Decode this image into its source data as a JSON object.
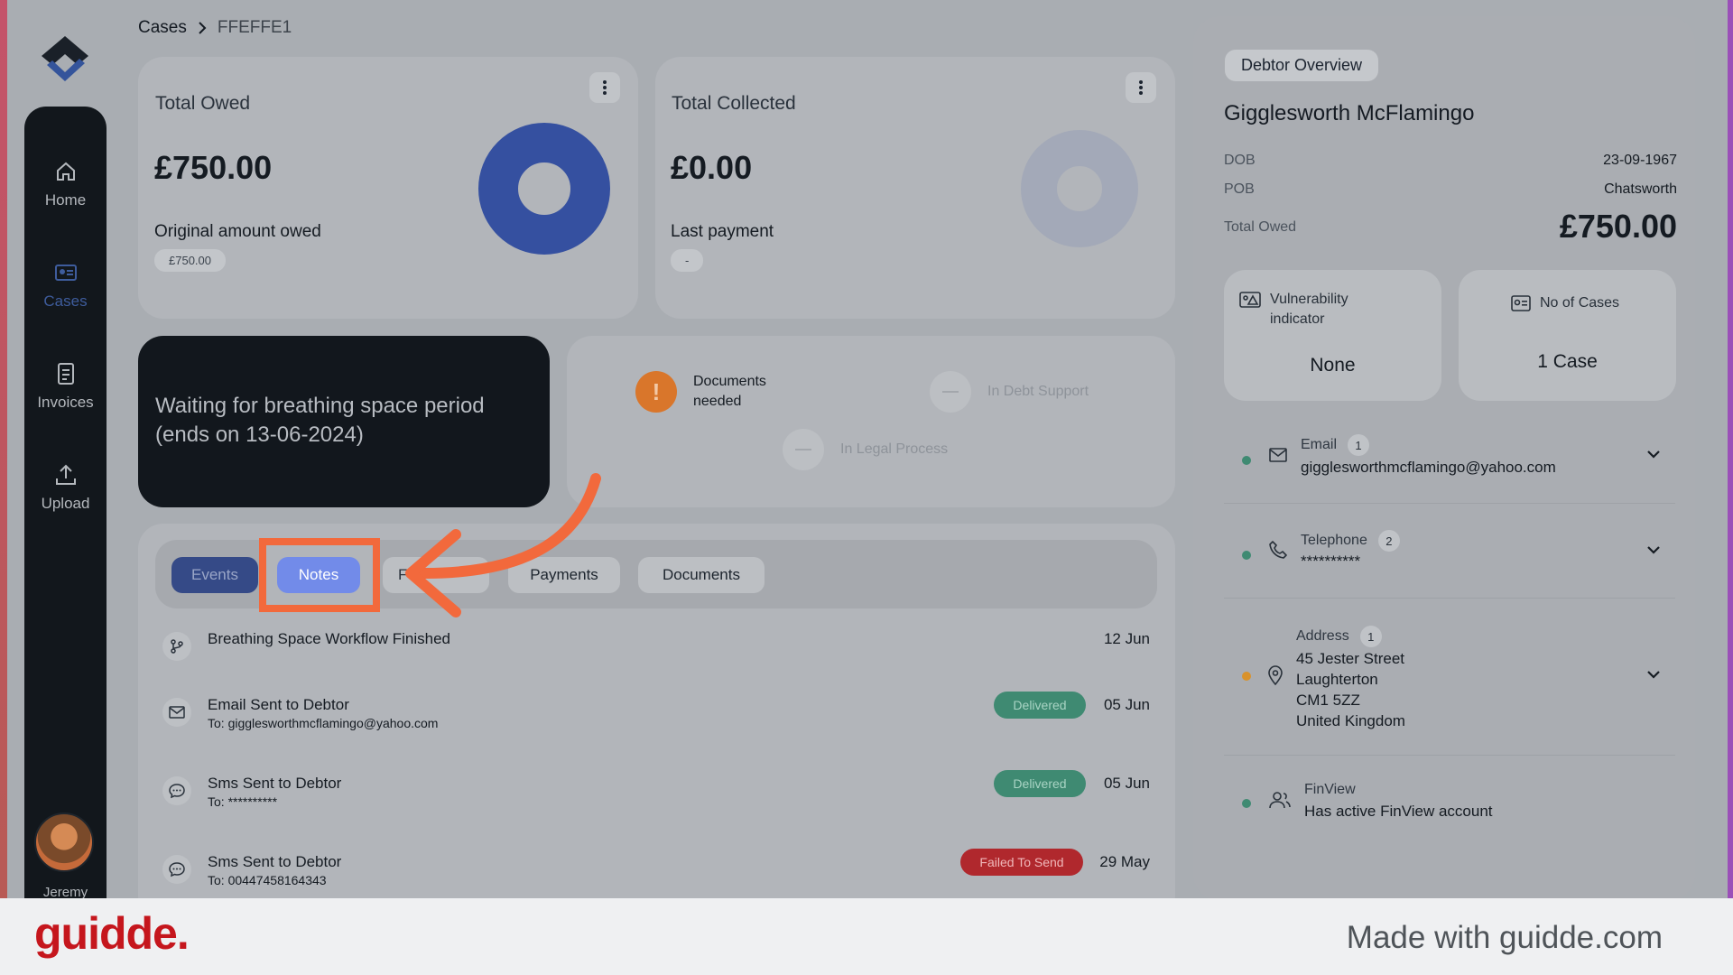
{
  "colors": {
    "accent": "#5b78e6",
    "brand_red": "#c5161d",
    "annotation": "#f2693c",
    "delivered": "#3f8a72",
    "failed": "#b0282d",
    "warning": "#d9762b"
  },
  "sidebar": {
    "items": [
      {
        "label": "Home",
        "icon": "home-icon",
        "active": false
      },
      {
        "label": "Cases",
        "icon": "cases-icon",
        "active": true
      },
      {
        "label": "Invoices",
        "icon": "invoice-icon",
        "active": false
      },
      {
        "label": "Upload",
        "icon": "upload-icon",
        "active": false
      }
    ],
    "user_name": "Jeremy"
  },
  "breadcrumb": {
    "root": "Cases",
    "current": "FFEFFE1"
  },
  "total_owed": {
    "title": "Total Owed",
    "amount": "£750.00",
    "sub_label": "Original amount owed",
    "sub_value": "£750.00"
  },
  "total_collected": {
    "title": "Total Collected",
    "amount": "£0.00",
    "sub_label": "Last payment",
    "sub_value": "-"
  },
  "status_message": "Waiting for breathing space period (ends on 13-06-2024)",
  "status_flags": [
    {
      "label": "Documents needed",
      "icon": "exclamation-icon",
      "active": true
    },
    {
      "label": "In Debt Support",
      "icon": "minus-icon",
      "active": false
    },
    {
      "label": "In Legal Process",
      "icon": "minus-icon",
      "active": false
    }
  ],
  "tabs": [
    {
      "label": "Events"
    },
    {
      "label": "Notes"
    },
    {
      "label": "F"
    },
    {
      "label": "Payments"
    },
    {
      "label": "Documents"
    }
  ],
  "events": [
    {
      "title": "Breathing Space Workflow Finished",
      "to": "",
      "status": "",
      "date": "12 Jun",
      "icon": "workflow-icon"
    },
    {
      "title": "Email Sent to Debtor",
      "to": "To: gigglesworthmcflamingo@yahoo.com",
      "status": "Delivered",
      "date": "05 Jun",
      "icon": "mail-icon"
    },
    {
      "title": "Sms Sent to Debtor",
      "to": "To: **********",
      "status": "Delivered",
      "date": "05 Jun",
      "icon": "sms-icon"
    },
    {
      "title": "Sms Sent to Debtor",
      "to": "To: 00447458164343",
      "status": "Failed To Send",
      "date": "29 May",
      "icon": "sms-icon"
    }
  ],
  "debtor": {
    "section_title": "Debtor Overview",
    "name": "Gigglesworth McFlamingo",
    "dob_label": "DOB",
    "dob": "23-09-1967",
    "pob_label": "POB",
    "pob": "Chatsworth",
    "owed_label": "Total Owed",
    "owed": "£750.00",
    "vulnerability_label": "Vulnerability indicator",
    "vulnerability_value": "None",
    "cases_label": "No of Cases",
    "cases_value": "1 Case",
    "email_label": "Email",
    "email_count": "1",
    "email": "gigglesworthmcflamingo@yahoo.com",
    "phone_label": "Telephone",
    "phone_count": "2",
    "phone": "**********",
    "address_label": "Address",
    "address_count": "1",
    "address_line1": "45 Jester Street",
    "address_line2": "Laughterton",
    "address_line3": "CM1 5ZZ",
    "address_line4": "United Kingdom",
    "finview_label": "FinView",
    "finview_value": "Has active FinView account"
  },
  "footer": {
    "logo": "guidde.",
    "tagline": "Made with guidde.com"
  }
}
